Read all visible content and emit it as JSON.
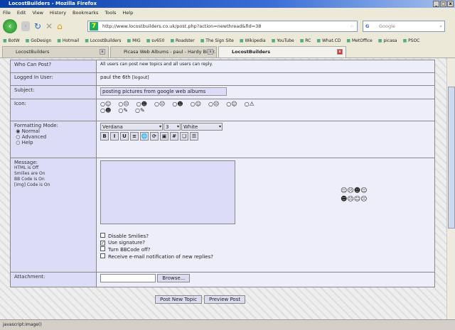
{
  "window": {
    "title": "LocostBuilders - Mozilla Firefox"
  },
  "menu": [
    "File",
    "Edit",
    "View",
    "History",
    "Bookmarks",
    "Tools",
    "Help"
  ],
  "url": "http://www.locostbuilders.co.uk/post.php?action=newthread&fid=38",
  "search_placeholder": "Google",
  "bookmarks": [
    "BotW",
    "GoDesign",
    "Hotmail",
    "LocostBuilders",
    "MIG",
    "sv650",
    "Roadster",
    "The Sign Site",
    "Wikipedia",
    "YouTube",
    "RC",
    "What.CD",
    "MetOffice",
    "picasa",
    "PSOC"
  ],
  "tabs": [
    {
      "label": "LocostBuilders"
    },
    {
      "label": "Picasa Web Albums - paul - Hardy Biker..."
    },
    {
      "label": "LocostBuilders"
    }
  ],
  "form": {
    "who_label": "Who Can Post?",
    "who_value": "All users can post new topics and all users can reply.",
    "user_label": "Logged In User:",
    "user_value": "paul the 6th",
    "logout": "[logout]",
    "subject_label": "Subject:",
    "subject_value": "posting pictures from google web albums",
    "icon_label": "Icon:",
    "icons": [
      "☺",
      "☹",
      "☻",
      "☹",
      "☻",
      "☺",
      "☹",
      "☺",
      "⚠",
      "☻",
      "✎",
      "✎"
    ],
    "format_label": "Formatting Mode:",
    "modes": [
      "Normal",
      "Advanced",
      "Help"
    ],
    "font": "Verdana",
    "size": "3",
    "color": "White",
    "toolbar": [
      "B",
      "I",
      "U",
      "≡",
      "🌐",
      "⟳",
      "▣",
      "#",
      "❏",
      "☰"
    ],
    "message_label": "Message:",
    "message_info": [
      "HTML is Off",
      "Smilies are On",
      "BB Code is On",
      "[img] Code is On"
    ],
    "smilies": "☺☹☻☺☻☹☺☹",
    "options": [
      {
        "label": "Disable Smilies?",
        "checked": false
      },
      {
        "label": "Use signature?",
        "checked": true
      },
      {
        "label": "Turn BBCode off?",
        "checked": false
      },
      {
        "label": "Receive e-mail notification of new replies?",
        "checked": false
      }
    ],
    "attachment_label": "Attachment:",
    "browse": "Browse...",
    "post_button": "Post New Topic",
    "preview_button": "Preview Post"
  },
  "status": "javascript:image()"
}
